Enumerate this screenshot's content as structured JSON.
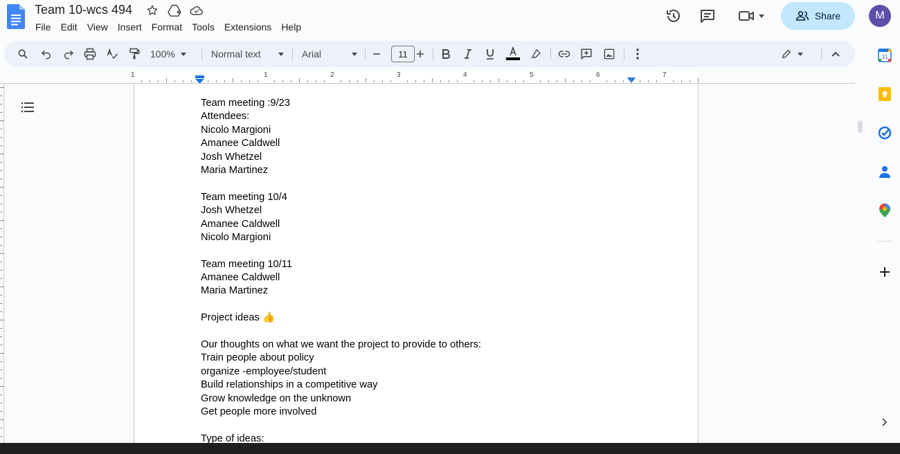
{
  "app": {
    "title": "Team 10-wcs 494",
    "menu": [
      "File",
      "Edit",
      "View",
      "Insert",
      "Format",
      "Tools",
      "Extensions",
      "Help"
    ],
    "share_label": "Share",
    "avatar_initial": "M"
  },
  "toolbar": {
    "zoom": "100%",
    "style": "Normal text",
    "font": "Arial",
    "font_size": "11"
  },
  "ruler": {
    "labels": [
      "1",
      "1",
      "2",
      "3",
      "4",
      "5",
      "6",
      "7"
    ]
  },
  "document": {
    "lines": [
      "Team meeting :9/23",
      "Attendees:",
      "Nicolo Margioni",
      "Amanee Caldwell",
      "Josh Whetzel",
      "Maria Martinez",
      "",
      "Team meeting 10/4",
      "Josh Whetzel",
      "Amanee Caldwell",
      "Nicolo Margioni",
      "",
      "Team meeting 10/11",
      "Amanee Caldwell",
      "Maria Martinez",
      "",
      "Project ideas 👍",
      "",
      "Our thoughts on what we want the project to provide to others:",
      "Train people about policy",
      "organize -employee/student",
      "Build relationships in a competitive way",
      "Grow knowledge on the unknown",
      "Get people more involved",
      "",
      "Type of ideas:"
    ]
  },
  "colors": {
    "accent": "#1a73e8",
    "share_bg": "#c2e7ff",
    "toolbar_bg": "#edf2fa",
    "avatar_bg": "#5c4fa8"
  }
}
